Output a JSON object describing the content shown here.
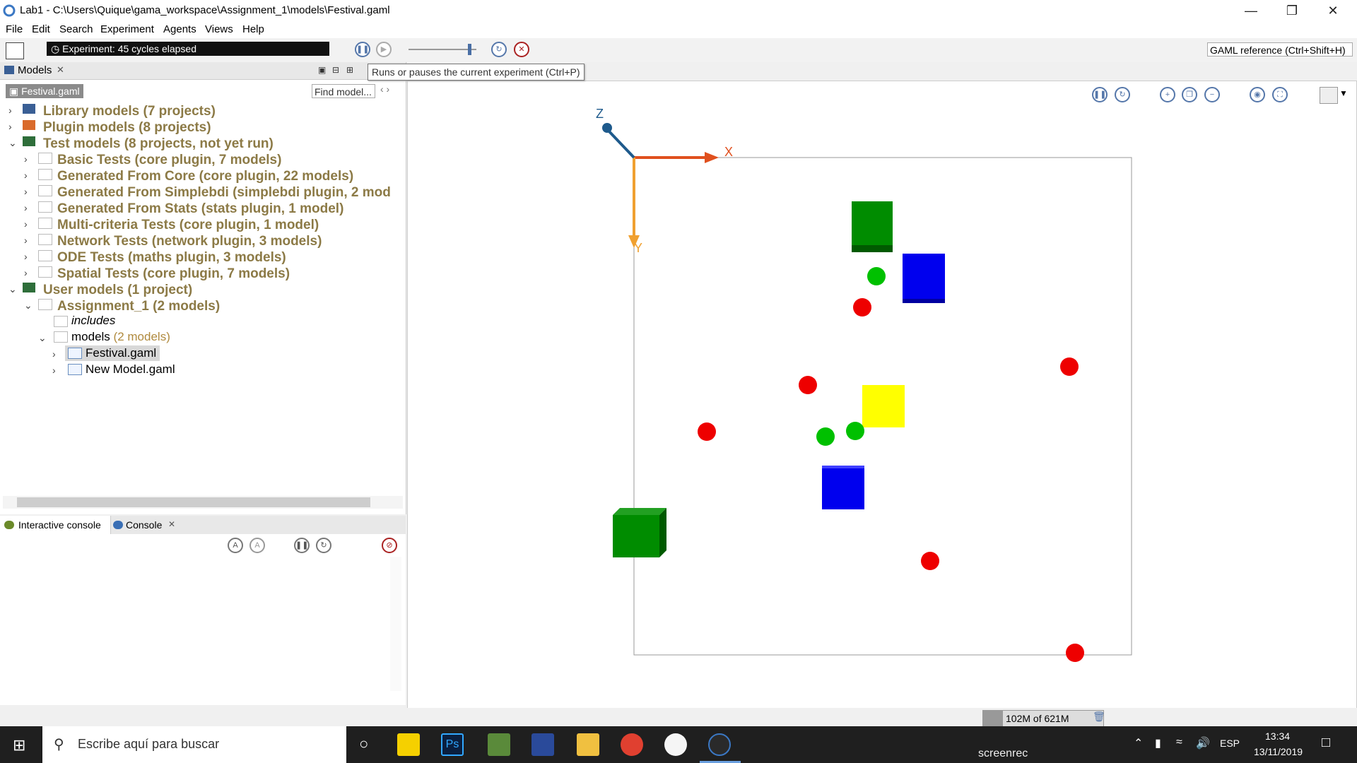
{
  "window": {
    "title": "Lab1 - C:\\Users\\Quique\\gama_workspace\\Assignment_1\\models\\Festival.gaml"
  },
  "menu": [
    "File",
    "Edit",
    "Search",
    "Experiment",
    "Agents",
    "Views",
    "Help"
  ],
  "toolbar": {
    "experiment_status": "Experiment: 45 cycles elapsed",
    "gaml_reference": "GAML reference (Ctrl+Shift+H)"
  },
  "tooltip": "Runs or pauses the current experiment (Ctrl+P)",
  "models_panel": {
    "tab_label": "Models",
    "breadcrumb": "Festival.gaml",
    "find_placeholder": "Find model...",
    "tree": [
      {
        "label": "Library models (7 projects)",
        "level": 0
      },
      {
        "label": "Plugin models (8 projects)",
        "level": 0
      },
      {
        "label": "Test models (8 projects, not yet run)",
        "level": 0
      },
      {
        "label": "Basic Tests (core plugin, 7 models)",
        "level": 1
      },
      {
        "label": "Generated From Core (core plugin, 22 models)",
        "level": 1
      },
      {
        "label": "Generated From Simplebdi (simplebdi plugin, 2 mod",
        "level": 1
      },
      {
        "label": "Generated From Stats (stats plugin, 1 model)",
        "level": 1
      },
      {
        "label": "Multi-criteria Tests (core plugin, 1 model)",
        "level": 1
      },
      {
        "label": "Network Tests (network plugin, 3 models)",
        "level": 1
      },
      {
        "label": "ODE Tests (maths plugin, 3 models)",
        "level": 1
      },
      {
        "label": "Spatial Tests (core plugin, 7 models)",
        "level": 1
      },
      {
        "label": "User models (1 project)",
        "level": 0
      },
      {
        "label": "Assignment_1 (2 models)",
        "level": 1
      },
      {
        "label": "includes",
        "level": 2
      },
      {
        "label": "models",
        "count": "(2 models)",
        "level": 2
      },
      {
        "label": "Festival.gaml",
        "level": 3
      },
      {
        "label": "New Model.gaml",
        "level": 3
      }
    ]
  },
  "console_panel": {
    "tab_interactive": "Interactive console",
    "tab_console": "Console"
  },
  "display": {
    "axis_x": "X",
    "axis_y": "Y",
    "axis_z": "Z"
  },
  "status": {
    "memory": "102M of 621M"
  },
  "taskbar": {
    "search_placeholder": "Escribe aquí para buscar",
    "lang": "ESP",
    "time": "13:34",
    "date": "13/11/2019",
    "recorder": "screenrec"
  },
  "colors": {
    "tree_bold": "#8c7a46",
    "green_agent": "#00c000",
    "red_agent": "#ee0000",
    "blue_block": "#0000ee",
    "green_block": "#008c00",
    "yellow_block": "#ffff00"
  }
}
